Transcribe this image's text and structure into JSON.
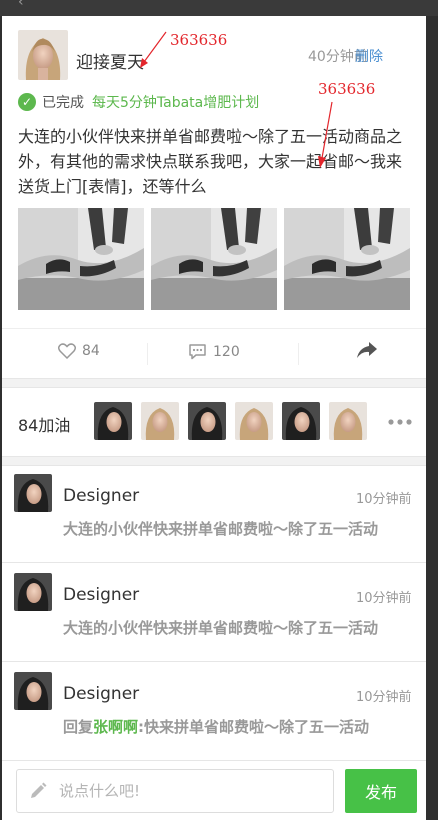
{
  "post": {
    "user_name": "迎接夏天",
    "time": "40分钟前",
    "delete_label": "删除",
    "status_text": "已完成",
    "plan_name": "每天5分钟Tabata增肥计划",
    "body": "大连的小伙伴快来拼单省邮费啦～除了五一活动商品之外，有其他的需求快点联系我吧，大家一起省邮～我来送货上门[表情]，还等什么",
    "photos_count": 3
  },
  "actions": {
    "like_icon": "heart-outline-icon",
    "like_count": "84",
    "comment_icon": "comment-bubble-icon",
    "comment_count": "120",
    "share_icon": "share-arrow-icon"
  },
  "cheer": {
    "label": "84加油",
    "avatars_shown": 6,
    "more_icon": "more-dots-icon"
  },
  "comments": [
    {
      "name": "Designer",
      "time": "10分钟前",
      "text": "大连的小伙伴快来拼单省邮费啦～除了五一活动"
    },
    {
      "name": "Designer",
      "time": "10分钟前",
      "text": "大连的小伙伴快来拼单省邮费啦～除了五一活动"
    },
    {
      "name": "Designer",
      "time": "10分钟前",
      "reply_prefix": "回复",
      "reply_to": "张啊啊",
      "reply_sep": ":",
      "text": "快来拼单省邮费啦～除了五一活动"
    }
  ],
  "input": {
    "placeholder": "说点什么吧!",
    "value": "",
    "icon": "pencil-icon",
    "send_label": "发布"
  },
  "annotations": [
    "363636",
    "363636"
  ],
  "colors": {
    "accent_green": "#5db84e",
    "send_green": "#47c147",
    "link_blue": "#4b8fd1",
    "text_dark": "#333333",
    "text_gray": "#999999",
    "annotation_red": "#e3262c",
    "frame_dark": "#2f2f2f"
  }
}
